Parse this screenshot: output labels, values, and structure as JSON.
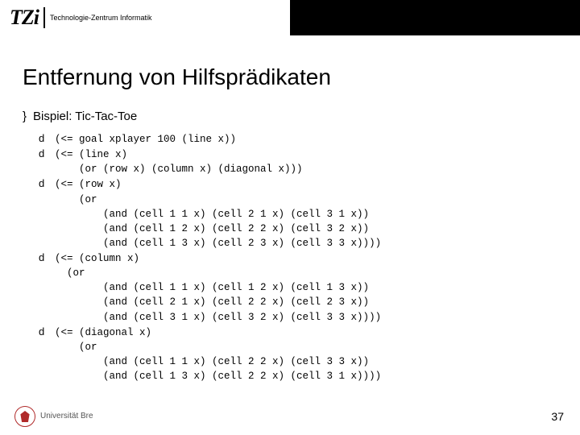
{
  "header": {
    "logo_mark": "TZi",
    "logo_text": "Technologie-Zentrum Informatik"
  },
  "title": "Entfernung von Hilfsprädikaten",
  "subhead": {
    "bullet": "}",
    "text": "Bispiel: Tic-Tac-Toe"
  },
  "codelines": [
    {
      "arrow": "d",
      "text": "(<= goal xplayer 100 (line x))"
    },
    {
      "arrow": "d",
      "text": "(<= (line x)"
    },
    {
      "arrow": "",
      "text": "    (or (row x) (column x) (diagonal x)))"
    },
    {
      "arrow": "d",
      "text": "(<= (row x)"
    },
    {
      "arrow": "",
      "text": "    (or "
    },
    {
      "arrow": "",
      "text": "        (and (cell 1 1 x) (cell 2 1 x) (cell 3 1 x))"
    },
    {
      "arrow": "",
      "text": "        (and (cell 1 2 x) (cell 2 2 x) (cell 3 2 x))"
    },
    {
      "arrow": "",
      "text": "        (and (cell 1 3 x) (cell 2 3 x) (cell 3 3 x))))"
    },
    {
      "arrow": "d",
      "text": "(<= (column x)"
    },
    {
      "arrow": "",
      "text": "  (or "
    },
    {
      "arrow": "",
      "text": "        (and (cell 1 1 x) (cell 1 2 x) (cell 1 3 x))"
    },
    {
      "arrow": "",
      "text": "        (and (cell 2 1 x) (cell 2 2 x) (cell 2 3 x))"
    },
    {
      "arrow": "",
      "text": "        (and (cell 3 1 x) (cell 3 2 x) (cell 3 3 x))))"
    },
    {
      "arrow": "d",
      "text": "(<= (diagonal x)"
    },
    {
      "arrow": "",
      "text": "    (or "
    },
    {
      "arrow": "",
      "text": "        (and (cell 1 1 x) (cell 2 2 x) (cell 3 3 x))"
    },
    {
      "arrow": "",
      "text": "        (and (cell 1 3 x) (cell 2 2 x) (cell 3 1 x))))"
    }
  ],
  "footer": {
    "uni_text": "Universität Bre",
    "page": "37"
  }
}
